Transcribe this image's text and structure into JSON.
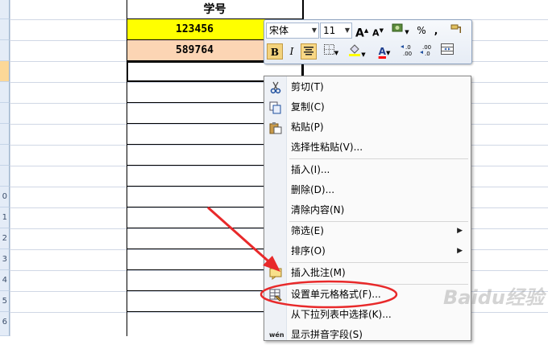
{
  "sheet": {
    "header_cell": "学号",
    "row1_value": "123456",
    "row2_value": "589764",
    "row_labels": [
      "",
      "",
      "",
      "",
      "",
      "",
      "",
      "",
      "",
      "0",
      "1",
      "2",
      "3",
      "4",
      "5",
      "6"
    ]
  },
  "minibar": {
    "font_name": "宋体",
    "font_size": "11",
    "bold_label": "B",
    "italic_label": "I",
    "percent_label": "%",
    "comma_label": ",",
    "font_color_label": "A",
    "grow_font_label": "A",
    "shrink_font_label": "A",
    "accent_yellow": "#ffff00",
    "accent_red": "#ff0000"
  },
  "menu": {
    "items": [
      {
        "label": "剪切(T)",
        "icon": "scissors-icon"
      },
      {
        "label": "复制(C)",
        "icon": "copy-icon"
      },
      {
        "label": "粘贴(P)",
        "icon": "paste-icon"
      },
      {
        "label": "选择性粘贴(V)..."
      },
      {
        "label": "插入(I)..."
      },
      {
        "label": "删除(D)..."
      },
      {
        "label": "清除内容(N)"
      },
      {
        "label": "筛选(E)",
        "submenu": true
      },
      {
        "label": "排序(O)",
        "submenu": true
      },
      {
        "label": "插入批注(M)",
        "icon": "comment-icon"
      },
      {
        "label": "设置单元格格式(F)...",
        "icon": "format-cells-icon"
      },
      {
        "label": "从下拉列表中选择(K)..."
      },
      {
        "label": "显示拼音字段(S)",
        "icon": "phonetic-icon"
      }
    ]
  },
  "colors": {
    "highlight_yellow": "#ffff00",
    "highlight_peach": "#fcd5b4",
    "annotation_red": "#e8292a"
  },
  "watermark": "Baidu经验"
}
